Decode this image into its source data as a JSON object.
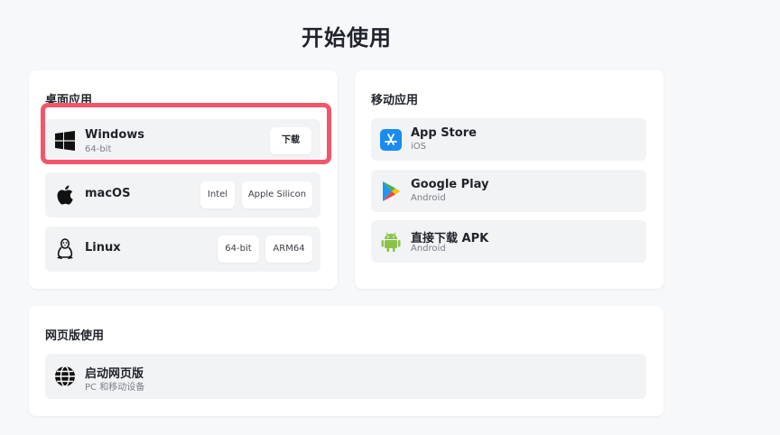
{
  "page_title": "开始使用",
  "desktop": {
    "title": "桌面应用",
    "windows": {
      "name": "Windows",
      "sub": "64-bit",
      "download_label": "下载",
      "icon": "windows-icon"
    },
    "macos": {
      "name": "macOS",
      "intel_label": "Intel",
      "apple_silicon_label": "Apple Silicon",
      "icon": "apple-icon"
    },
    "linux": {
      "name": "Linux",
      "x64_label": "64-bit",
      "arm_label": "ARM64",
      "icon": "linux-tux-icon"
    }
  },
  "mobile": {
    "title": "移动应用",
    "appstore": {
      "name": "App Store",
      "sub": "iOS",
      "icon": "app-store-icon"
    },
    "googleplay": {
      "name": "Google Play",
      "sub": "Android",
      "icon": "google-play-icon"
    },
    "apk": {
      "name": "直接下载 APK",
      "sub": "Android",
      "icon": "android-icon"
    }
  },
  "web": {
    "title": "网页版使用",
    "launch": {
      "name": "启动网页版",
      "sub": "PC 和移动设备",
      "icon": "globe-icon"
    }
  },
  "colors": {
    "highlight": "#f2566b",
    "app_store_blue": "#1a8cf0",
    "android_green": "#8bc34a"
  }
}
